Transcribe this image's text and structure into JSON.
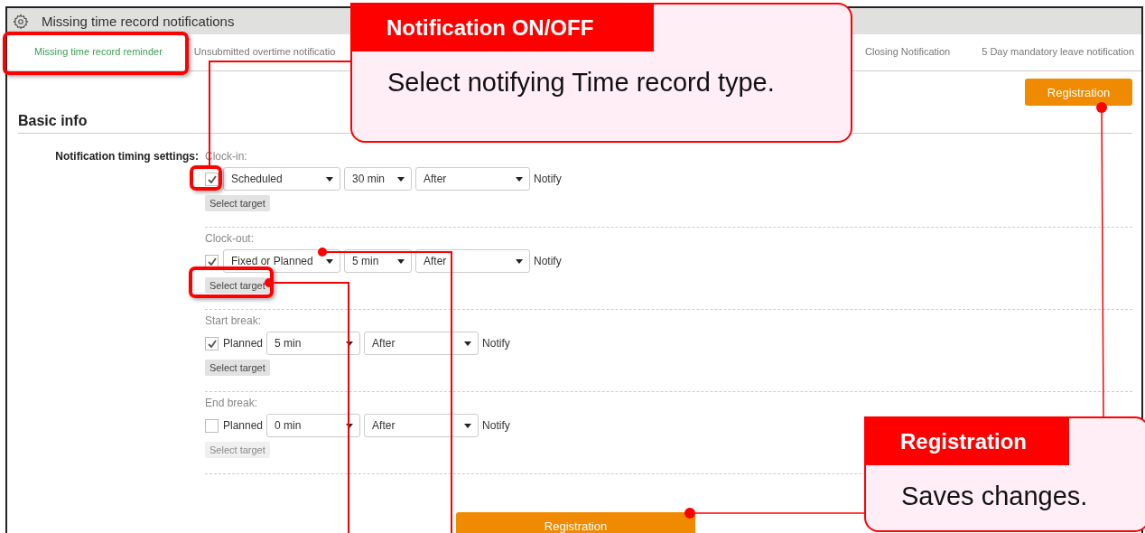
{
  "window": {
    "title": "Missing time record notifications"
  },
  "tabs": [
    {
      "label": "Missing time record reminder",
      "selected": true
    },
    {
      "label": "Unsubmitted overtime notificatio",
      "selected": false
    },
    {
      "label": "Closing Notification",
      "selected": false
    },
    {
      "label": "5 Day mandatory leave notification",
      "selected": false
    }
  ],
  "top_button": "Registration",
  "section_title": "Basic info",
  "field_label": "Notification timing settings:",
  "timings": [
    {
      "label": "Clock-in:",
      "checked": true,
      "type": {
        "kind": "select",
        "value": "Scheduled"
      },
      "minutes": "30 min",
      "timing": "After",
      "notify": "Notify",
      "target": {
        "label": "Select target",
        "disabled": false
      }
    },
    {
      "label": "Clock-out:",
      "checked": true,
      "type": {
        "kind": "select",
        "value": "Fixed or Planned"
      },
      "minutes": "5 min",
      "timing": "After",
      "notify": "Notify",
      "target": {
        "label": "Select target",
        "disabled": false
      }
    },
    {
      "label": "Start break:",
      "checked": true,
      "type": {
        "kind": "text",
        "value": "Planned"
      },
      "minutes": "5 min",
      "timing": "After",
      "notify": "Notify",
      "target": {
        "label": "Select target",
        "disabled": false
      }
    },
    {
      "label": "End break:",
      "checked": false,
      "type": {
        "kind": "text",
        "value": "Planned"
      },
      "minutes": "0 min",
      "timing": "After",
      "notify": "Notify",
      "target": {
        "label": "Select target",
        "disabled": true
      }
    }
  ],
  "bottom_button": "Registration",
  "callouts": [
    {
      "title": "Notification ON/OFF",
      "body": "Select notifying Time record type."
    },
    {
      "title": "Registration",
      "body": "Saves changes."
    }
  ]
}
